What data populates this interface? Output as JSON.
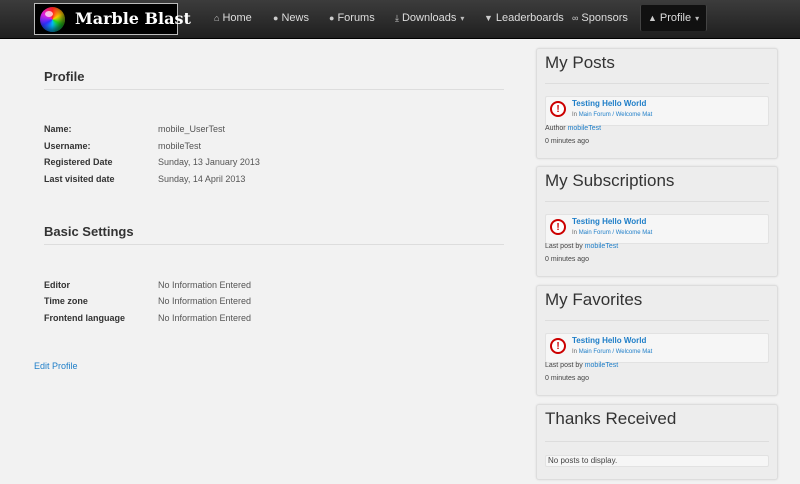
{
  "brand": {
    "name": "Marble Blast"
  },
  "nav": {
    "items": [
      {
        "label": "Home",
        "icon": "home-icon",
        "glyph": "⌂"
      },
      {
        "label": "News",
        "icon": "comment-icon",
        "glyph": "●"
      },
      {
        "label": "Forums",
        "icon": "comments-icon",
        "glyph": "●"
      },
      {
        "label": "Downloads",
        "icon": "download-icon",
        "glyph": "⤓",
        "caret": "▾"
      },
      {
        "label": "Leaderboards",
        "icon": "trophy-icon",
        "glyph": "▼"
      },
      {
        "label": "Sponsors",
        "icon": "link-icon",
        "glyph": "∞"
      },
      {
        "label": "Profile",
        "icon": "user-icon",
        "glyph": "▲",
        "caret": "▾"
      }
    ]
  },
  "profile": {
    "title": "Profile",
    "fields": [
      {
        "label": "Name:",
        "value": "mobile_UserTest"
      },
      {
        "label": "Username:",
        "value": "mobileTest"
      },
      {
        "label": "Registered Date",
        "value": "Sunday, 13 January 2013"
      },
      {
        "label": "Last visited date",
        "value": "Sunday, 14 April 2013"
      }
    ]
  },
  "settings": {
    "title": "Basic Settings",
    "fields": [
      {
        "label": "Editor",
        "value": "No Information Entered"
      },
      {
        "label": "Time zone",
        "value": "No Information Entered"
      },
      {
        "label": "Frontend language",
        "value": "No Information Entered"
      }
    ]
  },
  "edit_profile": "Edit Profile",
  "sidebar": {
    "posts": {
      "title": "My Posts",
      "item": {
        "title": "Testing Hello World",
        "in": "In",
        "category": "Main Forum / Welcome Mat"
      },
      "meta_label": "Author",
      "meta_user": "mobileTest",
      "time": "0 minutes ago"
    },
    "subscriptions": {
      "title": "My Subscriptions",
      "item": {
        "title": "Testing Hello World",
        "in": "In",
        "category": "Main Forum / Welcome Mat"
      },
      "meta_label": "Last post by",
      "meta_user": "mobileTest",
      "time": "0 minutes ago"
    },
    "favorites": {
      "title": "My Favorites",
      "item": {
        "title": "Testing Hello World",
        "in": "In",
        "category": "Main Forum / Welcome Mat"
      },
      "meta_label": "Last post by",
      "meta_user": "mobileTest",
      "time": "0 minutes ago"
    },
    "thanks": {
      "title": "Thanks Received",
      "empty": "No posts to display."
    }
  },
  "colors": {
    "link": "#1e7ec8",
    "alert": "#cc0000",
    "navbar": "#2a2a2a"
  }
}
